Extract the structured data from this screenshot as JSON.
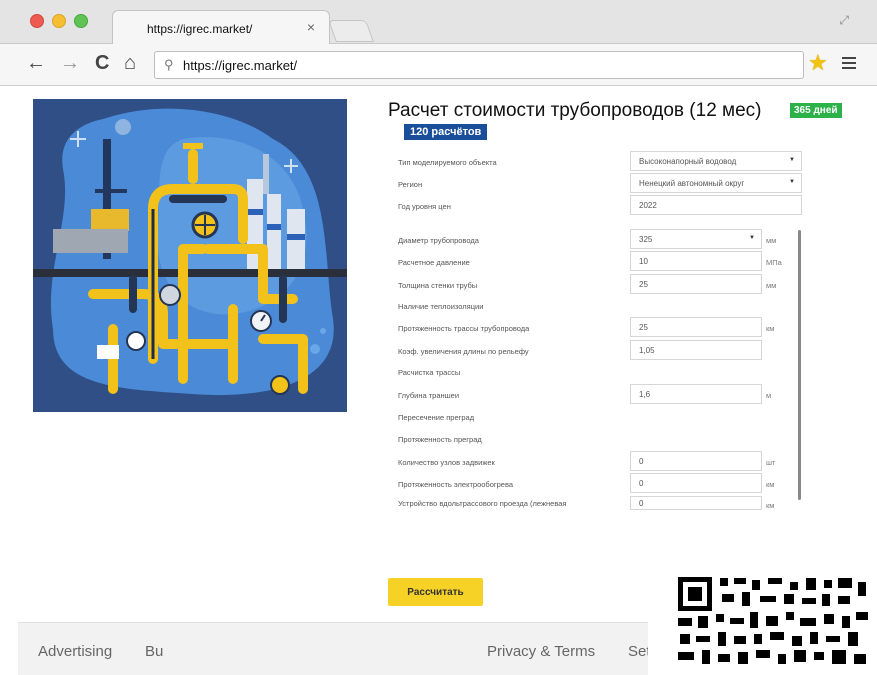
{
  "browser": {
    "tab_title": "https://igrec.market/",
    "url": "https://igrec.market/",
    "icons": [
      "back-icon",
      "forward-icon",
      "reload-icon",
      "home-icon",
      "search-icon",
      "star-icon",
      "menu-icon",
      "close-icon"
    ]
  },
  "calculator": {
    "title": "Расчет стоимости трубопроводов (12 мес)",
    "days_badge": "365 дней",
    "count_badge": "120 расчётов",
    "object_type": {
      "label": "Тип моделируемого объекта",
      "value": "Высоконапорный водовод"
    },
    "region": {
      "label": "Регион",
      "value": "Ненецкий автономный округ"
    },
    "price_year": {
      "label": "Год уровня цен",
      "value": "2022"
    },
    "diameter": {
      "label": "Диаметр трубопровода",
      "value": "325",
      "unit": "мм"
    },
    "pressure": {
      "label": "Расчетное давление",
      "value": "10",
      "unit": "МПа"
    },
    "wall_thickness": {
      "label": "Толщина стенки трубы",
      "value": "25",
      "unit": "мм"
    },
    "insulation": {
      "label": "Наличие теплоизоляции"
    },
    "route_length": {
      "label": "Протяженность трассы трубопровода",
      "value": "25",
      "unit": "км"
    },
    "relief_coef": {
      "label": "Коэф. увеличения длины по рельефу",
      "value": "1,05"
    },
    "clearing": {
      "label": "Расчистка трассы"
    },
    "trench_depth": {
      "label": "Глубина траншеи",
      "value": "1,6",
      "unit": "м"
    },
    "crossing": {
      "label": "Пересечение преград"
    },
    "crossing_length": {
      "label": "Протяженность преград"
    },
    "valve_count": {
      "label": "Количество узлов задвижек",
      "value": "0",
      "unit": "шт"
    },
    "heating_length": {
      "label": "Протяженность электрообогрева",
      "value": "0",
      "unit": "км"
    },
    "road": {
      "label": "Устройство вдольтрассового проезда (лежневая",
      "value": "0",
      "unit": "км"
    },
    "calculate_button": "Рассчитать"
  },
  "footer": {
    "advertising": "Advertising",
    "business_partial": "Bu",
    "privacy": "Privacy & Terms",
    "settings_partial": "Set"
  },
  "colors": {
    "accent_yellow": "#f7d226",
    "badge_green": "#2db24a",
    "badge_blue": "#1a4e9b",
    "pipe_yellow": "#f2c21b"
  }
}
